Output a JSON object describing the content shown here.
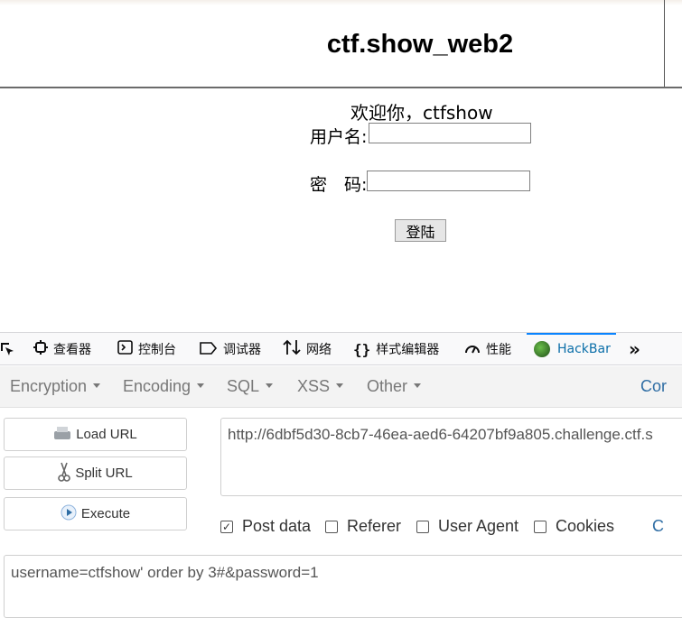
{
  "page": {
    "title": "ctf.show_web2",
    "welcome": "欢迎你，ctfshow",
    "username_label": "用户名:",
    "password_label": "密　码:",
    "username_value": "",
    "password_value": "",
    "login_button": "登陆"
  },
  "devtools": {
    "tabs": [
      {
        "label": "查看器",
        "icon": "inspector-icon"
      },
      {
        "label": "控制台",
        "icon": "console-icon"
      },
      {
        "label": "调试器",
        "icon": "debugger-icon"
      },
      {
        "label": "网络",
        "icon": "network-icon"
      },
      {
        "label": "样式编辑器",
        "icon": "style-editor-icon"
      },
      {
        "label": "性能",
        "icon": "performance-icon"
      },
      {
        "label": "HackBar",
        "icon": "hackbar-icon"
      }
    ],
    "active_tab": "HackBar"
  },
  "hackbar": {
    "menus": [
      "Encryption",
      "Encoding",
      "SQL",
      "XSS",
      "Other"
    ],
    "contribute_link": "Cor",
    "buttons": {
      "load_url": "Load URL",
      "split_url": "Split URL",
      "execute": "Execute"
    },
    "url_value": "http://6dbf5d30-8cb7-46ea-aed6-64207bf9a805.challenge.ctf.s",
    "options": [
      {
        "label": "Post data",
        "checked": true
      },
      {
        "label": "Referer",
        "checked": false
      },
      {
        "label": "User Agent",
        "checked": false
      },
      {
        "label": "Cookies",
        "checked": false
      }
    ],
    "clear_link": "C",
    "post_data": "username=ctfshow' order by 3#&password=1"
  }
}
